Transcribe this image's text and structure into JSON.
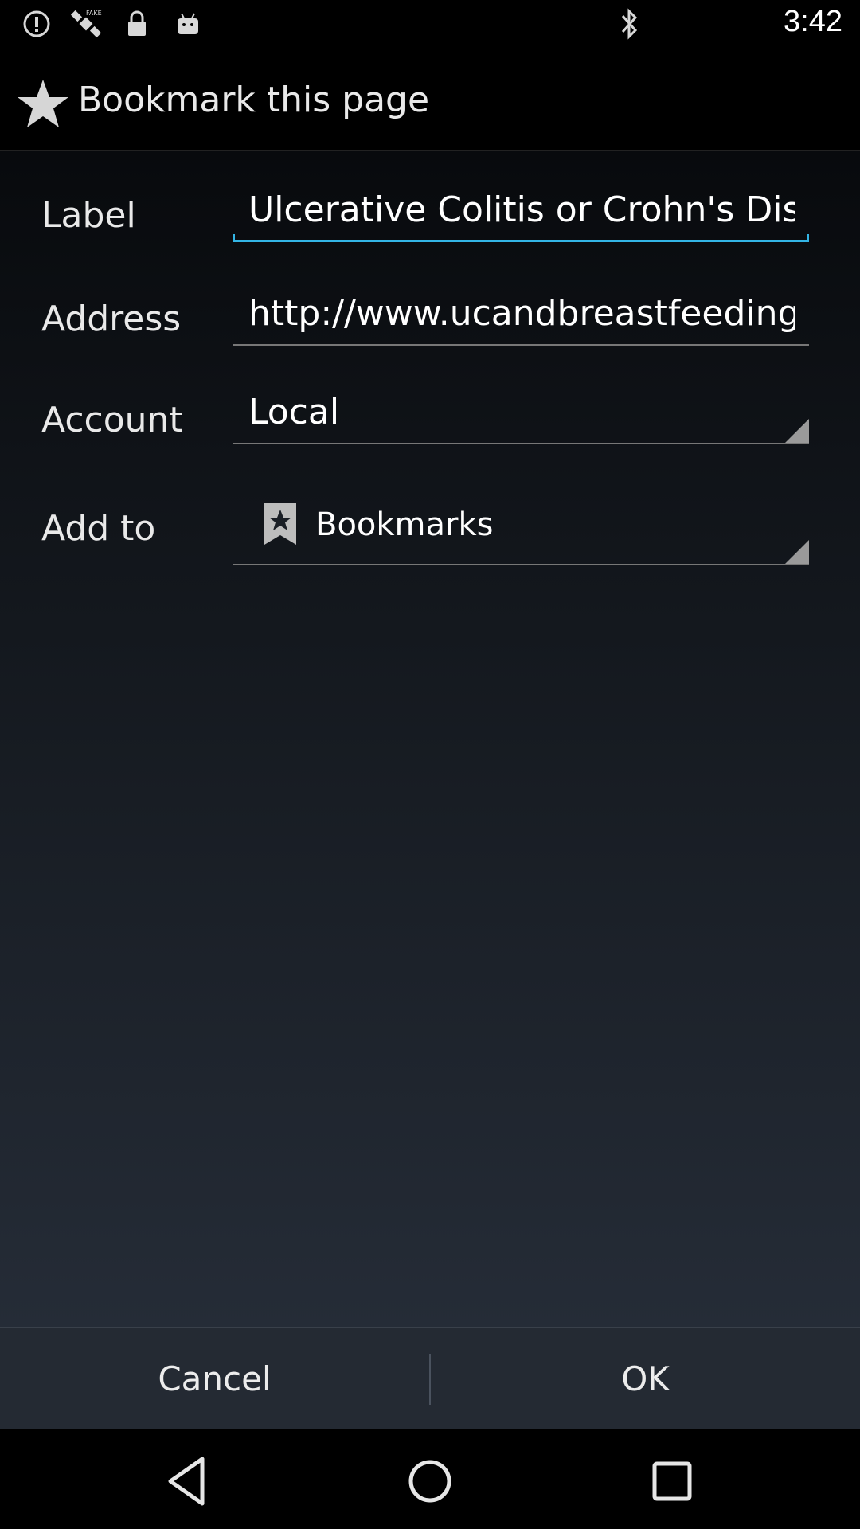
{
  "status_bar": {
    "time": "3:42",
    "left_icons": [
      "alert-circle-icon",
      "satellite-icon",
      "lock-icon",
      "android-icon"
    ],
    "right_icons": [
      "bluetooth-icon"
    ]
  },
  "dialog": {
    "title": "Bookmark this page",
    "fields": {
      "label": {
        "name": "Label",
        "value": "Ulcerative Colitis or Crohn's Disease"
      },
      "address": {
        "name": "Address",
        "value": "http://www.ucandbreastfeeding.com"
      },
      "account": {
        "name": "Account",
        "value": "Local"
      },
      "add_to": {
        "name": "Add to",
        "value": "Bookmarks"
      }
    },
    "buttons": {
      "cancel": "Cancel",
      "ok": "OK"
    }
  },
  "colors": {
    "accent": "#33b5e5",
    "background_top": "#080a0d",
    "background_bottom": "#252c37",
    "buttonbar": "#242a33"
  }
}
